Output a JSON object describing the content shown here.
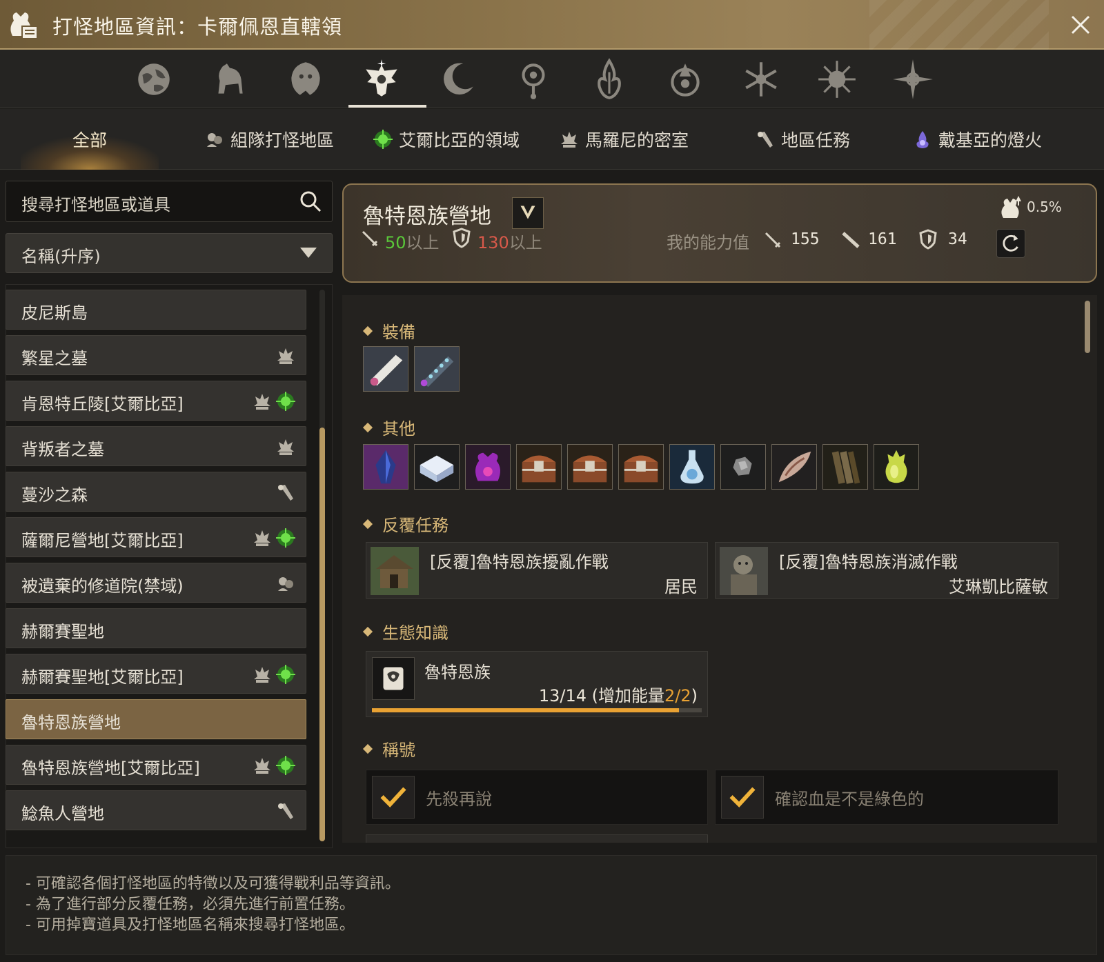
{
  "window": {
    "title": "打怪地區資訊：卡爾佩恩直轄領"
  },
  "icon_tabs": [
    {
      "icon": "globe-icon"
    },
    {
      "icon": "horse-icon"
    },
    {
      "icon": "lion-icon"
    },
    {
      "icon": "eagle-crest-icon",
      "selected": true
    },
    {
      "icon": "crescent-moon-icon"
    },
    {
      "icon": "eye-crest-icon"
    },
    {
      "icon": "flame-crest-icon"
    },
    {
      "icon": "triskele-icon"
    },
    {
      "icon": "snowflake-icon"
    },
    {
      "icon": "sunburst-icon"
    },
    {
      "icon": "compass-star-icon"
    }
  ],
  "tabs": {
    "all": "全部",
    "party": "組隊打怪地區",
    "elvia": "艾爾比亞的領域",
    "marni": "馬羅尼的密室",
    "quests": "地區任務",
    "dehkia": "戴基亞的燈火"
  },
  "search": {
    "placeholder": "搜尋打怪地區或道具"
  },
  "sort": {
    "value": "名稱(升序)"
  },
  "zones": [
    {
      "name": "皮尼斯島",
      "icons": []
    },
    {
      "name": "繁星之墓",
      "icons": [
        "marni-icon"
      ]
    },
    {
      "name": "肯恩特丘陵[艾爾比亞]",
      "icons": [
        "marni-icon",
        "elvia-icon"
      ]
    },
    {
      "name": "背叛者之墓",
      "icons": [
        "marni-icon"
      ]
    },
    {
      "name": "蔓沙之森",
      "icons": [
        "quest-icon"
      ]
    },
    {
      "name": "薩爾尼營地[艾爾比亞]",
      "icons": [
        "marni-icon",
        "elvia-icon"
      ]
    },
    {
      "name": "被遺棄的修道院(禁域)",
      "icons": [
        "party-icon"
      ]
    },
    {
      "name": "赫爾賽聖地",
      "icons": []
    },
    {
      "name": "赫爾賽聖地[艾爾比亞]",
      "icons": [
        "marni-icon",
        "elvia-icon"
      ]
    },
    {
      "name": "魯特恩族營地",
      "icons": [],
      "selected": true
    },
    {
      "name": "魯特恩族營地[艾爾比亞]",
      "icons": [
        "marni-icon",
        "elvia-icon"
      ]
    },
    {
      "name": "鯰魚人營地",
      "icons": [
        "quest-icon"
      ]
    }
  ],
  "info": {
    "zone_name": "魯特恩族營地",
    "ap_req": "50",
    "ap_suffix": "以上",
    "dp_req": "130",
    "dp_suffix": "以上",
    "my_stats_label": "我的能力值",
    "my_ap": "155",
    "my_aap": "161",
    "my_dp": "34",
    "drop_rate": "0.5%"
  },
  "sections": {
    "equipment": "裝備",
    "other": "其他",
    "repeat_quests": "反覆任務",
    "ecology": "生態知識",
    "titles": "稱號"
  },
  "equipment_items": [
    {
      "icon": "scroll-weapon-icon"
    },
    {
      "icon": "chain-weapon-icon"
    }
  ],
  "other_items": [
    {
      "icon": "dark-crystal-icon"
    },
    {
      "icon": "white-box-icon"
    },
    {
      "icon": "purple-pouch-icon"
    },
    {
      "icon": "treasure-chest-icon"
    },
    {
      "icon": "treasure-chest-icon"
    },
    {
      "icon": "treasure-chest-icon"
    },
    {
      "icon": "potion-icon"
    },
    {
      "icon": "ore-icon"
    },
    {
      "icon": "fang-icon"
    },
    {
      "icon": "log-icon"
    },
    {
      "icon": "fruit-icon"
    }
  ],
  "repeat_quests": [
    {
      "name": "[反覆]魯特恩族擾亂作戰",
      "giver": "居民"
    },
    {
      "name": "[反覆]魯特恩族消滅作戰",
      "giver": "艾琳凱比薩敏"
    }
  ],
  "ecology": {
    "name": "魯特恩族",
    "progress_prefix": "13/14 (增加能量",
    "progress_highlight": "2/2",
    "progress_suffix": ")",
    "fill_fraction": 0.93
  },
  "titles": [
    {
      "name": "先殺再說"
    },
    {
      "name": "確認血是不是綠色的"
    }
  ],
  "footer": [
    "- 可確認各個打怪地區的特徵以及可獲得戰利品等資訊。",
    "- 為了進行部分反覆任務，必須先進行前置任務。",
    "- 可用掉寶道具及打怪地區名稱來搜尋打怪地區。"
  ],
  "colors": {
    "accent_gold": "#d8b878",
    "selection_brown": "#7b6443",
    "progress_orange": "#e9a233",
    "stat_ok_green": "#5ac93a",
    "stat_bad_red": "#d8594a"
  }
}
